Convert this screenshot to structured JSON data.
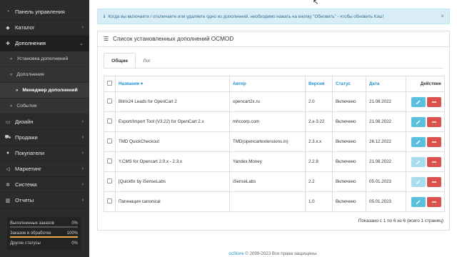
{
  "sidebar": {
    "items": [
      {
        "label": "Панель управления",
        "icon": "dashboard-icon"
      },
      {
        "label": "Каталог",
        "icon": "tag-icon"
      },
      {
        "label": "Дополнения",
        "icon": "puzzle-icon"
      }
    ],
    "extensions_sub": [
      {
        "label": "Установка дополнений"
      },
      {
        "label": "Дополнения"
      },
      {
        "label": "Менеджер дополнений"
      },
      {
        "label": "События"
      }
    ],
    "items_after": [
      {
        "label": "Дизайн",
        "icon": "monitor-icon"
      },
      {
        "label": "Продажи",
        "icon": "cart-icon"
      },
      {
        "label": "Покупатели",
        "icon": "user-icon"
      },
      {
        "label": "Маркетинг",
        "icon": "share-icon"
      },
      {
        "label": "Система",
        "icon": "gear-icon"
      },
      {
        "label": "Отчеты",
        "icon": "chart-icon"
      }
    ],
    "stats": [
      {
        "label": "Выполненных заказов",
        "value": "0%",
        "fill": 0
      },
      {
        "label": "Заказов в обработке",
        "value": "100%",
        "fill": 1
      },
      {
        "label": "Другие статусы",
        "value": "0%",
        "fill": 0
      }
    ]
  },
  "alert": {
    "text": "Когда вы включаете / отключаете или удаляете одно из дополнений, необходимо нажать на кнопку \"Обновить\" - чтобы обновить Кэш!",
    "close": "×"
  },
  "panel": {
    "title": "Список установленных дополнений OCMOD",
    "tabs": [
      "Общие",
      "Лог"
    ]
  },
  "table": {
    "headers": {
      "name": "Название",
      "author": "Автор",
      "version": "Версия",
      "status": "Статус",
      "date": "Дата",
      "action": "Действие"
    },
    "rows": [
      {
        "name": "Bitrix24 Leads for OpenCart 2",
        "author": "opencart2x.ru",
        "version": "2.0",
        "status": "Включено",
        "date": "21.08.2022",
        "dim": false
      },
      {
        "name": "Export/Import Tool (V3.22) for OpenCart 2.x",
        "author": "mhccorp.com",
        "version": "2.x-3.22",
        "status": "Включено",
        "date": "21.08.2022",
        "dim": false
      },
      {
        "name": "TMD QuickCheckout",
        "author": "TMD(opencartextensions.in)",
        "version": "2.3.x.x",
        "status": "Включено",
        "date": "26.12.2022",
        "dim": false
      },
      {
        "name": "Y.CMS for Opencart 2.0.x - 2.3.x",
        "author": "Yandex.Money",
        "version": "2.2.8",
        "status": "Включено",
        "date": "21.08.2022",
        "dim": true
      },
      {
        "name": "[Quickfix by iSenseLabs",
        "author": "iSenseLabs",
        "version": "2.2",
        "status": "Включено",
        "date": "05.01.2023",
        "dim": true
      },
      {
        "name": "Пагинация canonical",
        "author": "",
        "version": "1.0",
        "status": "Включено",
        "date": "05.01.2023",
        "dim": false
      }
    ]
  },
  "pager": {
    "text": "Показано с 1 по 6 из 6 (всего 1 страниц)"
  },
  "footer": {
    "brand": "ocStore",
    "text": " © 2009-2023 Все права защищены."
  }
}
